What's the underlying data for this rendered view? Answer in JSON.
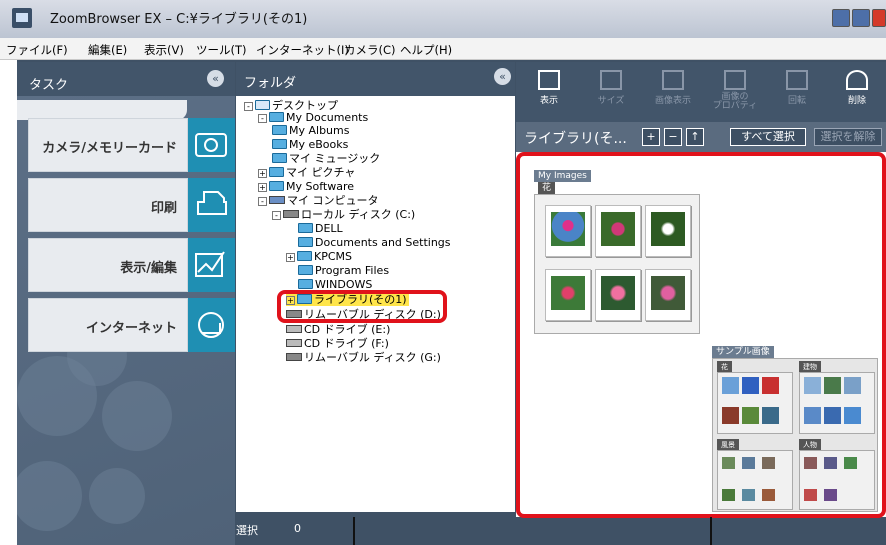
{
  "window": {
    "title": "ZoomBrowser EX  –  C:¥ライブラリ(その1)"
  },
  "menu": [
    "ファイル(F)",
    "編集(E)",
    "表示(V)",
    "ツール(T)",
    "インターネット(I)",
    "カメラ(C)",
    "ヘルプ(H)"
  ],
  "task_panel": {
    "title": "タスク",
    "buttons": [
      "カメラ/メモリーカード",
      "印刷",
      "表示/編集",
      "インターネット"
    ]
  },
  "folder_panel": {
    "title": "フォルダ",
    "tree": [
      "デスクトップ",
      "My Documents",
      "My Albums",
      "My eBooks",
      "マイ ミュージック",
      "マイ ピクチャ",
      "My Software",
      "マイ コンピュータ",
      "ローカル ディスク (C:)",
      "DELL",
      "Documents and Settings",
      "KPCMS",
      "Program Files",
      "WINDOWS",
      "ライブラリ(その1)",
      "リムーバブル ディスク (D:)",
      "CD ドライブ (E:)",
      "CD ドライブ (F:)",
      "リムーバブル ディスク (G:)"
    ],
    "status_label": "選択",
    "status_count": "0"
  },
  "toolbar": [
    "表示",
    "サイズ",
    "画像表示",
    "画像の\nプロパティ",
    "回転",
    "削除"
  ],
  "pathbar": {
    "path": "ライブラリ(そ...",
    "select_all": "すべて選択",
    "deselect": "選択を解除"
  },
  "gallery": {
    "folder1": {
      "name": "My Images",
      "sub": "花"
    },
    "folder2": {
      "name": "サンプル画像",
      "subs": [
        "花",
        "建物",
        "風景",
        "人物"
      ]
    }
  },
  "colors": {
    "accent": "#1f8fb3",
    "panel": "#42556a",
    "highlight": "#e0121b"
  }
}
